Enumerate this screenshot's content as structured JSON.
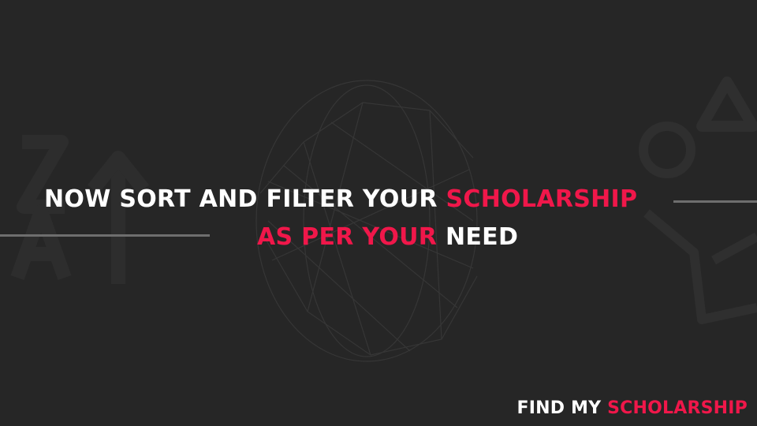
{
  "headline": {
    "line1_white": "NOW SORT AND FILTER YOUR ",
    "line1_accent": "SCHOLARSHIP",
    "line2_accent": "AS PER YOUR ",
    "line2_white": "NEED"
  },
  "brand": {
    "white": "FIND MY ",
    "accent": "SCHOLARSHIP"
  },
  "colors": {
    "background": "#262626",
    "accent": "#f0174a",
    "text": "#ffffff",
    "divider": "#6e6e6e"
  },
  "icons": [
    "sort-az-icon",
    "funnel-icon",
    "triangle-icon",
    "circle-icon"
  ]
}
